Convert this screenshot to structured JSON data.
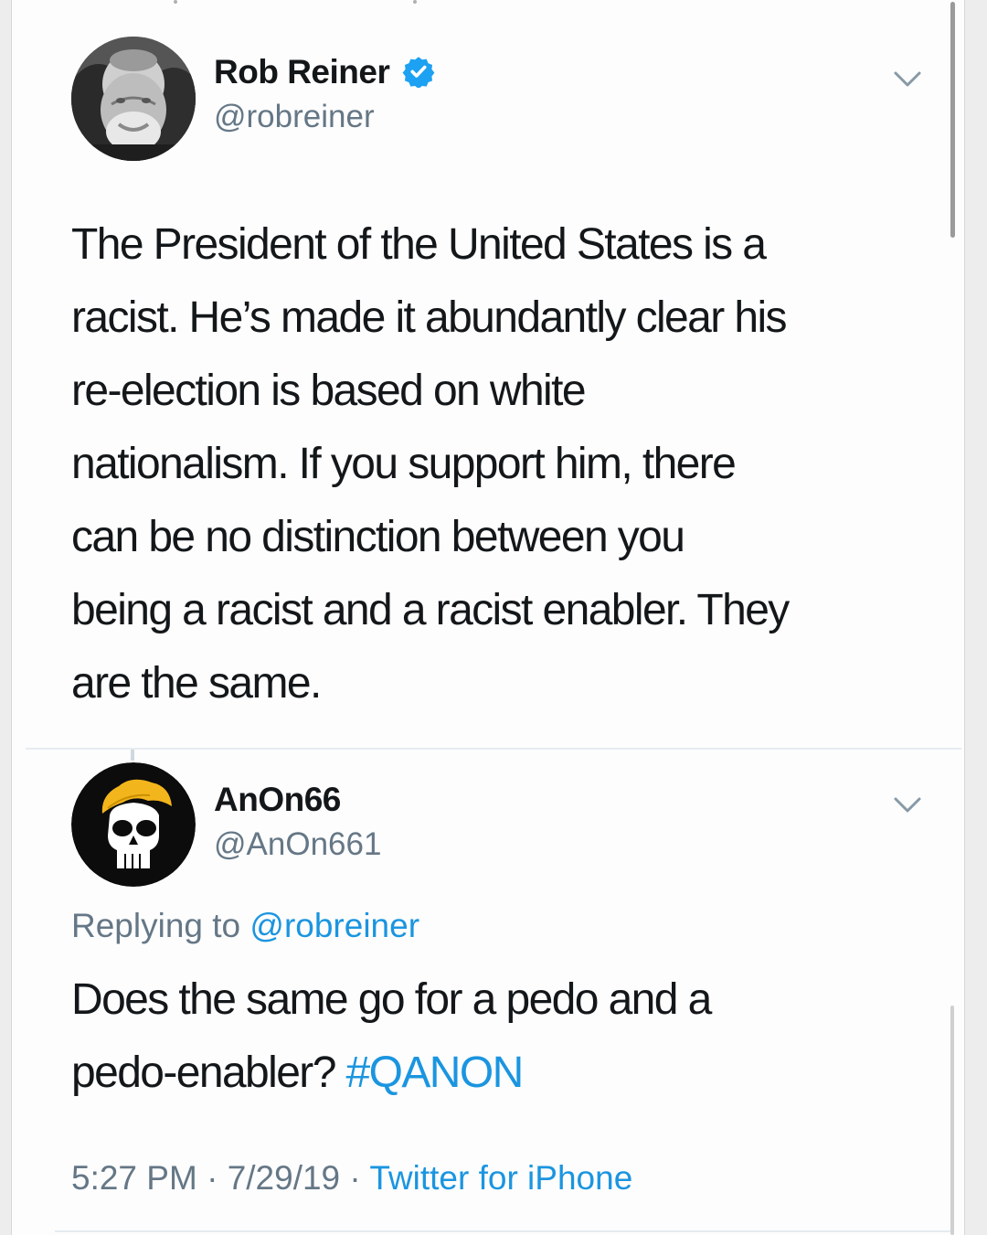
{
  "tweets": [
    {
      "name": "Rob Reiner",
      "verified": true,
      "handle": "@robreiner",
      "lines": [
        "The President of the United States is a",
        "racist. He’s made it abundantly clear his",
        "re-election is based on white",
        "nationalism. If you support him, there",
        "can be no distinction between you",
        "being a racist and a racist enabler. They",
        "are the same."
      ]
    },
    {
      "name": "AnOn66",
      "handle": "@AnOn661",
      "replying_prefix": "Replying to",
      "replying_to": "@robreiner",
      "line1": "Does the same go for a pedo and a",
      "line2_text": "pedo-enabler? ",
      "hashtag": "#QANON",
      "time": "5:27 PM",
      "sep1": " · ",
      "date": "7/29/19",
      "sep2": " · ",
      "source": "Twitter for iPhone"
    }
  ],
  "colors": {
    "accent": "#1b95e0",
    "secondary_text": "#657786",
    "primary_text": "#14171a",
    "verified_badge": "#1da1f2",
    "avatar2_hair": "#f2b51b"
  },
  "icons": {
    "verified": "verified-badge-icon",
    "menu": "chevron-down-icon"
  }
}
